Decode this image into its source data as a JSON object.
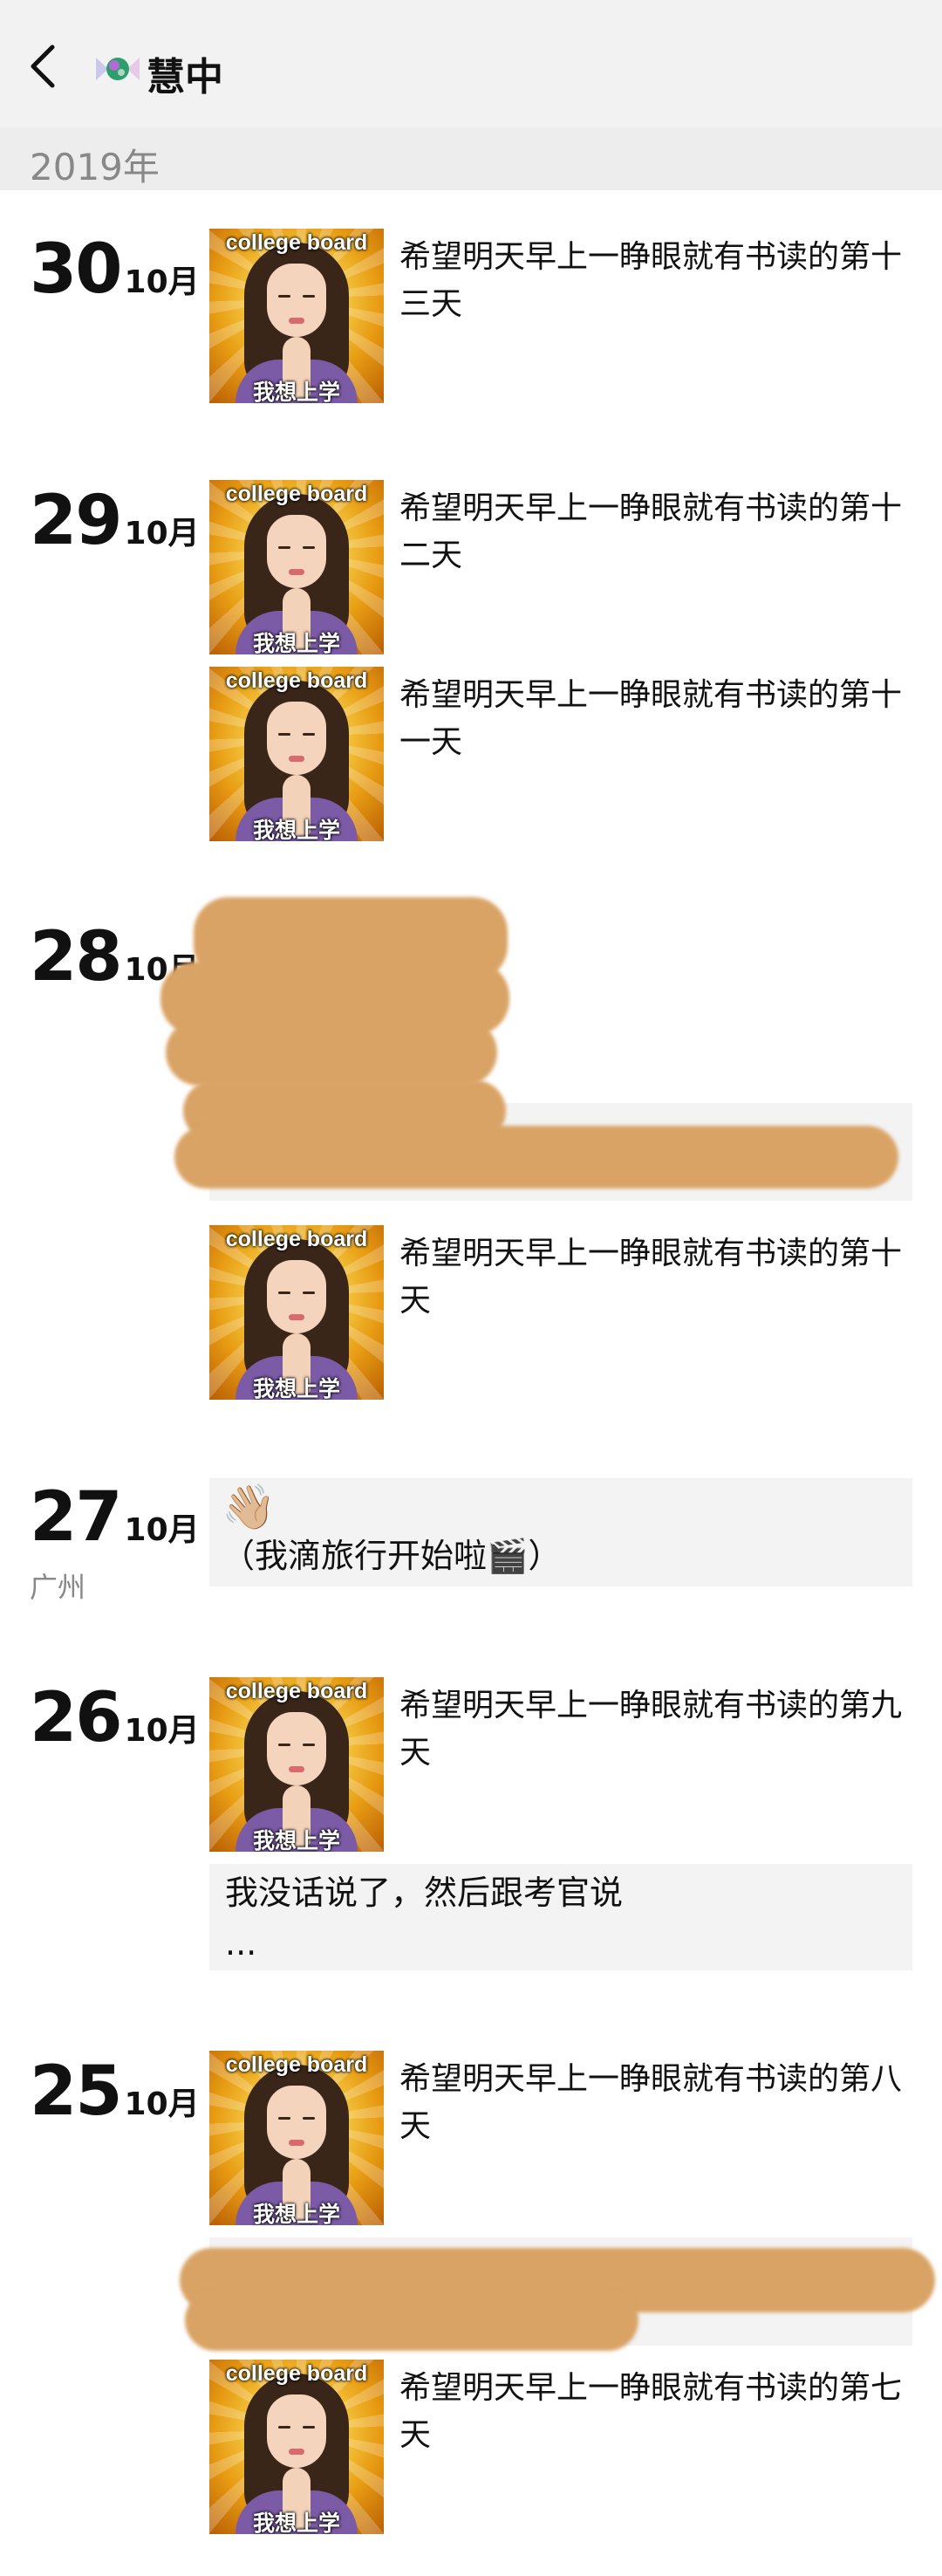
{
  "header": {
    "back_icon": "chevron-left-icon",
    "avatar_icon": "candy-icon",
    "title": "慧中"
  },
  "year": "2019年",
  "thumbnail": {
    "caption_top": "college board",
    "caption_bottom": "我想上学"
  },
  "entries": [
    {
      "day": "30",
      "month": "10月",
      "posts": [
        {
          "type": "image_text",
          "text": "希望明天早上一睁眼就有书读的第十三天"
        }
      ]
    },
    {
      "day": "29",
      "month": "10月",
      "posts": [
        {
          "type": "image_text",
          "text": "希望明天早上一睁眼就有书读的第十二天"
        },
        {
          "type": "image_text",
          "text": "希望明天早上一睁眼就有书读的第十一天"
        }
      ]
    },
    {
      "day": "28",
      "month": "10月",
      "posts": [
        {
          "type": "redacted"
        },
        {
          "type": "image_text",
          "text": "希望明天早上一睁眼就有书读的第十天"
        }
      ]
    },
    {
      "day": "27",
      "month": "10月",
      "location": "广州",
      "posts": [
        {
          "type": "text",
          "emoji": "👋🏼",
          "text": "（我滴旅行开始啦🎬）"
        }
      ]
    },
    {
      "day": "26",
      "month": "10月",
      "posts": [
        {
          "type": "image_text",
          "text": "希望明天早上一睁眼就有书读的第九天"
        },
        {
          "type": "text",
          "text": "我没话说了，然后跟考官说",
          "text2": "..."
        }
      ]
    },
    {
      "day": "25",
      "month": "10月",
      "posts": [
        {
          "type": "image_text",
          "text": "希望明天早上一睁眼就有书读的第八天"
        },
        {
          "type": "redacted"
        },
        {
          "type": "image_text",
          "text": "希望明天早上一睁眼就有书读的第七天"
        }
      ]
    }
  ],
  "colors": {
    "header_bg": "#f2f2f2",
    "year_bar_bg": "#ededed",
    "text_post_bg": "#f3f3f3",
    "redaction": "#d9a365"
  }
}
